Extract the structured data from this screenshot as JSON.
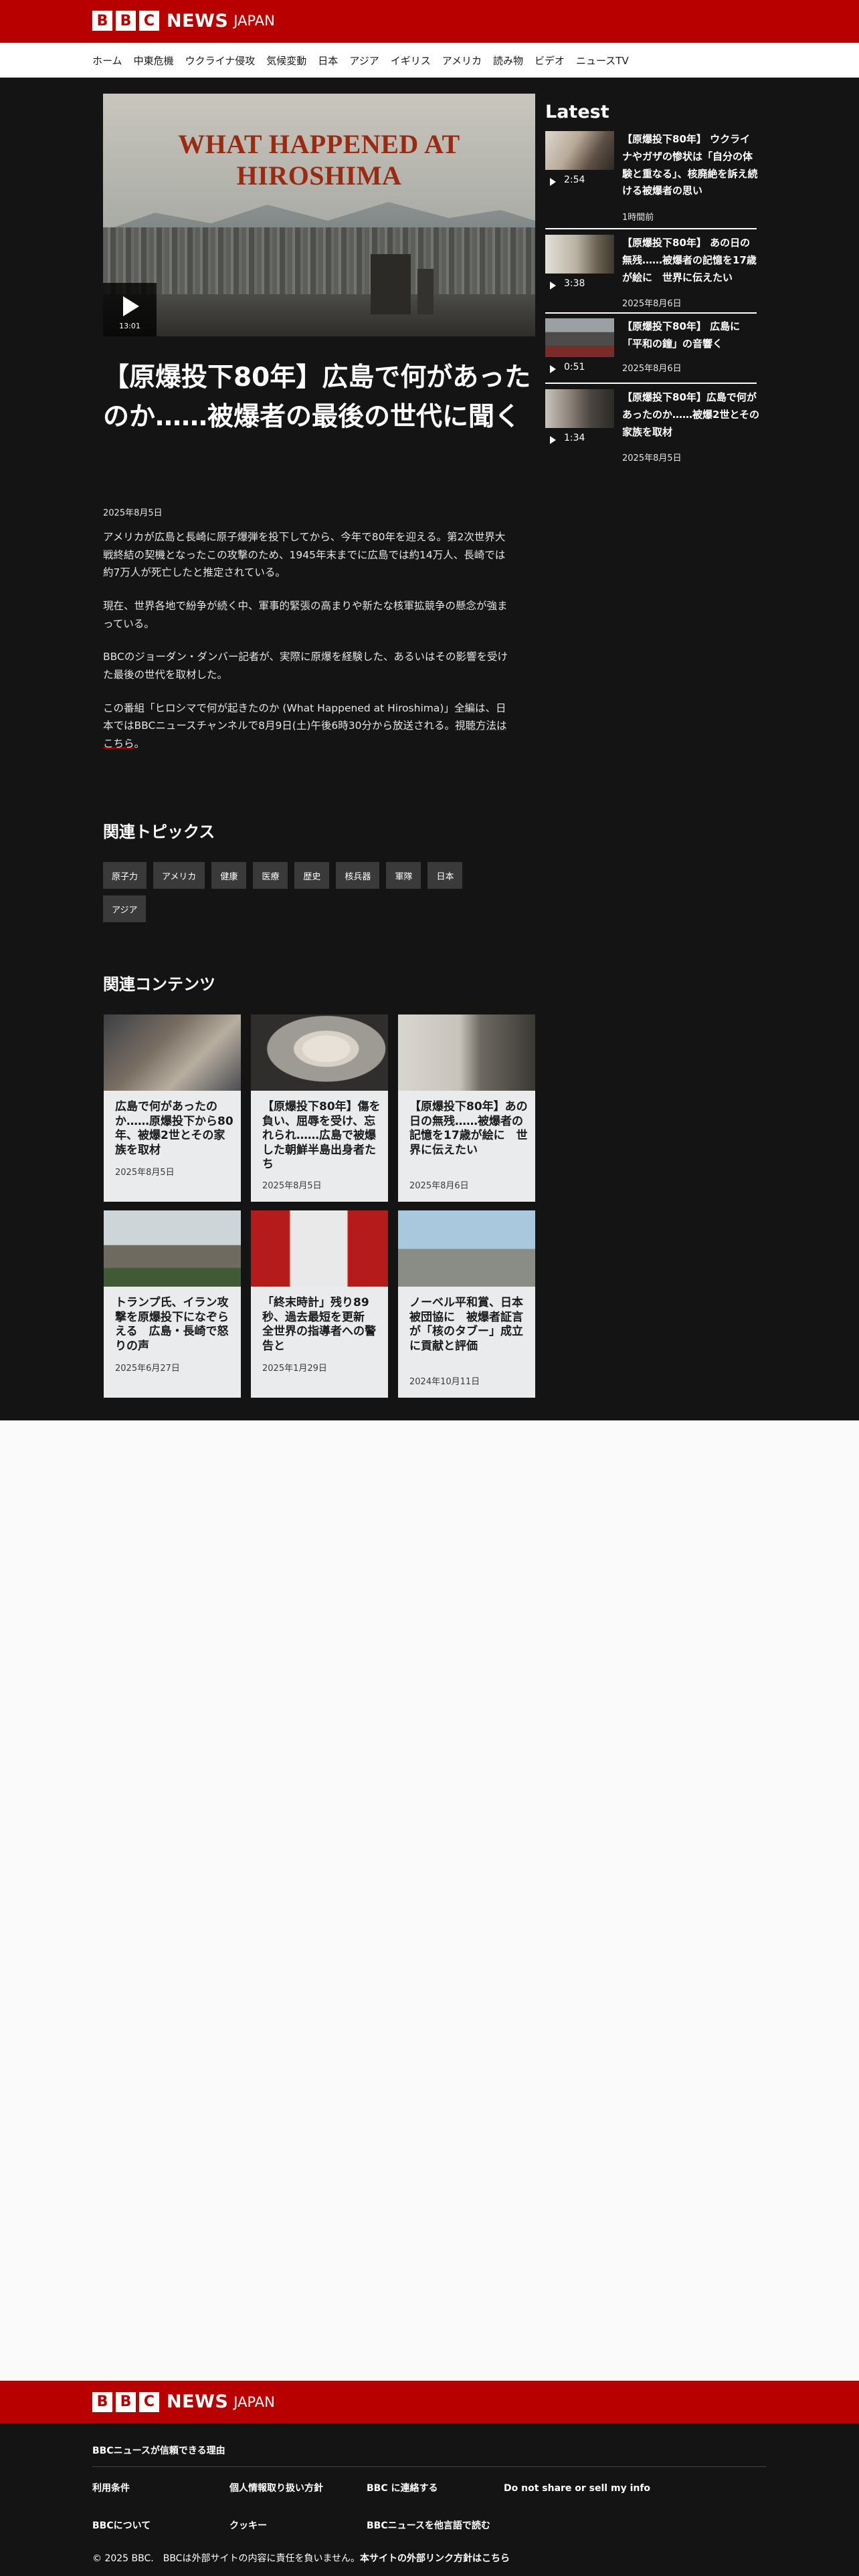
{
  "header": {
    "logo_letters": [
      "B",
      "B",
      "C"
    ],
    "logo_news": "NEWS",
    "logo_japan": "JAPAN",
    "nav": [
      "ホーム",
      "中東危機",
      "ウクライナ侵攻",
      "気候変動",
      "日本",
      "アジア",
      "イギリス",
      "アメリカ",
      "読み物",
      "ビデオ",
      "ニュースTV"
    ]
  },
  "video": {
    "title_text": "WHAT HAPPENED AT HIROSHIMA",
    "duration": "13:01",
    "icon": "play-icon"
  },
  "article": {
    "headline": "【原爆投下80年】広島で何があったのか……被爆者の最後の世代に聞く",
    "date": "2025年8月5日",
    "paragraphs": [
      "アメリカが広島と長崎に原子爆弾を投下してから、今年で80年を迎える。第2次世界大戦終結の契機となったこの攻撃のため、1945年末までに広島では約14万人、長崎では約7万人が死亡したと推定されている。",
      "現在、世界各地で紛争が続く中、軍事的緊張の高まりや新たな核軍拡競争の懸念が強まっている。",
      "BBCのジョーダン・ダンバー記者が、実際に原爆を経験した、あるいはその影響を受けた最後の世代を取材した。"
    ],
    "last_paragraph": "この番組「ヒロシマで何が起きたのか (What Happened at Hiroshima)」全編は、日本ではBBCニュースチャンネルで8月9日(土)午後6時30分から放送される。",
    "last_link": "視聴方法はこちら",
    "last_end": "。"
  },
  "topics": {
    "title": "関連トピックス",
    "tags": [
      "原子力",
      "アメリカ",
      "健康",
      "医療",
      "歴史",
      "核兵器",
      "軍隊",
      "日本",
      "アジア"
    ]
  },
  "related": {
    "title": "関連コンテンツ",
    "cards": [
      {
        "title": "広島で何があったのか……原爆投下から80年、被爆2世とその家族を取材",
        "date": "2025年8月5日"
      },
      {
        "title": "【原爆投下80年】傷を負い、屈辱を受け、忘れられ……広島で被爆した朝鮮半島出身者たち",
        "date": "2025年8月5日"
      },
      {
        "title": "【原爆投下80年】あの日の無残……被爆者の記憶を17歳が絵に　世界に伝えたい",
        "date": "2025年8月6日"
      },
      {
        "title": "トランプ氏、イラン攻撃を原爆投下になぞらえる　広島・長崎で怒りの声",
        "date": "2025年6月27日"
      },
      {
        "title": "「終末時計」残り89秒、過去最短を更新　全世界の指導者への警告と",
        "date": "2025年1月29日"
      },
      {
        "title": "ノーベル平和賞、日本被団協に　被爆者証言が「核のタブー」成立に貢献と評価",
        "date": "2024年10月11日"
      }
    ]
  },
  "latest": {
    "title": "Latest",
    "items": [
      {
        "duration": "2:54",
        "title": "【原爆投下80年】 ウクライナやガザの惨状は「自分の体験と重なる」、核廃絶を訴え続ける被爆者の思い",
        "date": "1時間前"
      },
      {
        "duration": "3:38",
        "title": "【原爆投下80年】 あの日の無残……被爆者の記憶を17歳が絵に　世界に伝えたい",
        "date": "2025年8月6日"
      },
      {
        "duration": "0:51",
        "title": "【原爆投下80年】 広島に「平和の鐘」の音響く",
        "date": "2025年8月6日"
      },
      {
        "duration": "1:34",
        "title": "【原爆投下80年】広島で何があったのか……被爆2世とその家族を取材",
        "date": "2025年8月5日"
      }
    ]
  },
  "footer": {
    "why_trust": "BBCニュースが信頼できる理由",
    "links": [
      "利用条件",
      "個人情報取り扱い方針",
      "BBC に連絡する",
      "Do not share or sell my info",
      "BBCについて",
      "クッキー",
      "BBCニュースを他言語で読む"
    ],
    "copyright": "© 2025 BBC.　BBCは外部サイトの内容に責任を負いません。",
    "external_policy": "本サイトの外部リンク方針はこちら"
  },
  "colors": {
    "brand_red": "#b80000",
    "dark_bg": "#141414",
    "page_bg": "#fafafa",
    "tag_bg": "#3a3a3a",
    "card_bg": "#e9ebec"
  }
}
